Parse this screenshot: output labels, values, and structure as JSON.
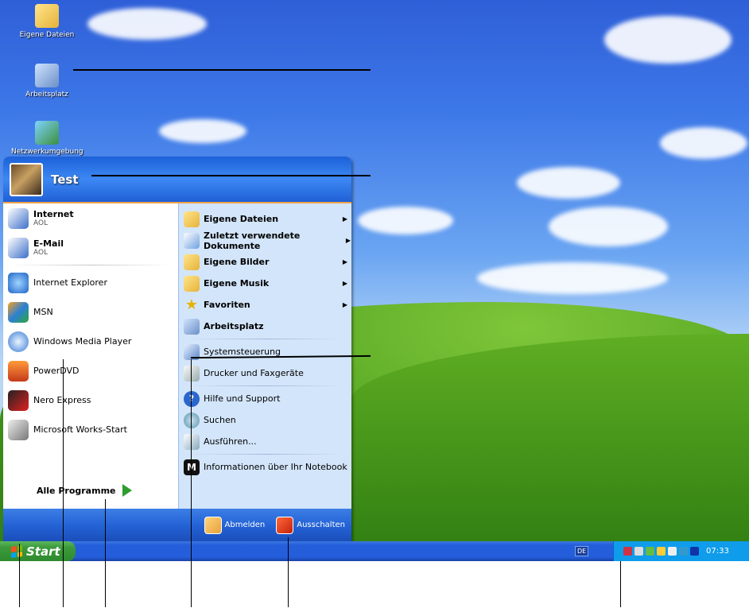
{
  "desktop": {
    "icons": [
      {
        "label": "Eigene Dateien",
        "icon": "folder-icon"
      },
      {
        "label": "Arbeitsplatz",
        "icon": "computer-icon"
      },
      {
        "label": "Netzwerkumgebung",
        "icon": "network-icon"
      }
    ]
  },
  "start_menu": {
    "username": "Test",
    "pinned": [
      {
        "label": "Internet",
        "sub": "AOL",
        "icon": "aol-icon"
      },
      {
        "label": "E-Mail",
        "sub": "AOL",
        "icon": "aol-mail-icon"
      }
    ],
    "recent": [
      {
        "label": "Internet Explorer",
        "icon": "internet-explorer-icon"
      },
      {
        "label": "MSN",
        "icon": "msn-butterfly-icon"
      },
      {
        "label": "Windows Media Player",
        "icon": "media-player-icon"
      },
      {
        "label": "PowerDVD",
        "icon": "powerdvd-icon"
      },
      {
        "label": "Nero Express",
        "icon": "nero-icon"
      },
      {
        "label": "Microsoft Works-Start",
        "icon": "works-icon"
      }
    ],
    "all_programs": "Alle Programme",
    "places": [
      {
        "label": "Eigene Dateien",
        "arrow": true
      },
      {
        "label": "Zuletzt verwendete Dokumente",
        "arrow": true
      },
      {
        "label": "Eigene Bilder",
        "arrow": true
      },
      {
        "label": "Eigene Musik",
        "arrow": true
      },
      {
        "label": "Favoriten",
        "arrow": true
      },
      {
        "label": "Arbeitsplatz",
        "arrow": false
      }
    ],
    "settings": [
      {
        "label": "Systemsteuerung"
      },
      {
        "label": "Drucker und Faxgeräte"
      }
    ],
    "help": [
      {
        "label": "Hilfe und Support"
      },
      {
        "label": "Suchen"
      },
      {
        "label": "Ausführen..."
      }
    ],
    "oem": {
      "label": "Informationen über Ihr Notebook"
    },
    "logoff": "Abmelden",
    "shutdown": "Ausschalten"
  },
  "taskbar": {
    "start_label": "Start",
    "language": "DE",
    "clock": "07:33"
  },
  "colors": {
    "taskbar": "#245edb",
    "start_button": "#3c9a3c",
    "menu_header": "#1c60d8",
    "menu_right_pane": "#d3e5fa",
    "tray": "#0f9ceb"
  }
}
